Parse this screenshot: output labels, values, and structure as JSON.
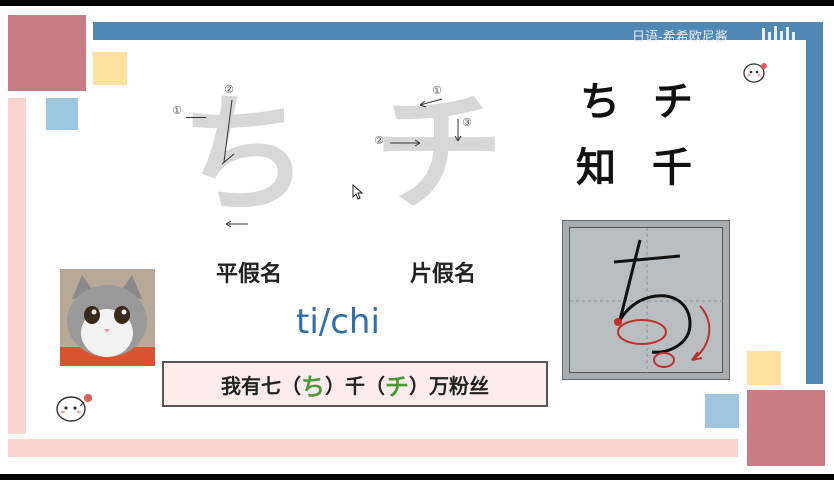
{
  "watermark": "日语-希希欧尼酱",
  "kana": {
    "hiragana_char": "ち",
    "katakana_char": "チ",
    "hiragana_label": "平假名",
    "katakana_label": "片假名",
    "romaji": "ti/chi"
  },
  "stroke_numbers": {
    "hira_1": "①",
    "hira_2": "②",
    "kata_1": "①",
    "kata_2": "②",
    "kata_3": "③"
  },
  "origin_pairs": {
    "row1_left": "ち",
    "row1_right": "チ",
    "row2_left": "知",
    "row2_right": "千"
  },
  "mnemonic": {
    "part1": "我有七（",
    "hira": "ち",
    "part2": "）千（",
    "kata": "チ",
    "part3": "）万粉丝"
  },
  "colors": {
    "blue_bar": "#4f87b5",
    "pink_bar": "#f9d5cf",
    "rose_block": "#c97b84",
    "yellow_block": "#fde1a0",
    "light_blue_block": "#9ec7df",
    "green_text": "#4a9a3a",
    "romaji_blue": "#2f6fb0"
  }
}
